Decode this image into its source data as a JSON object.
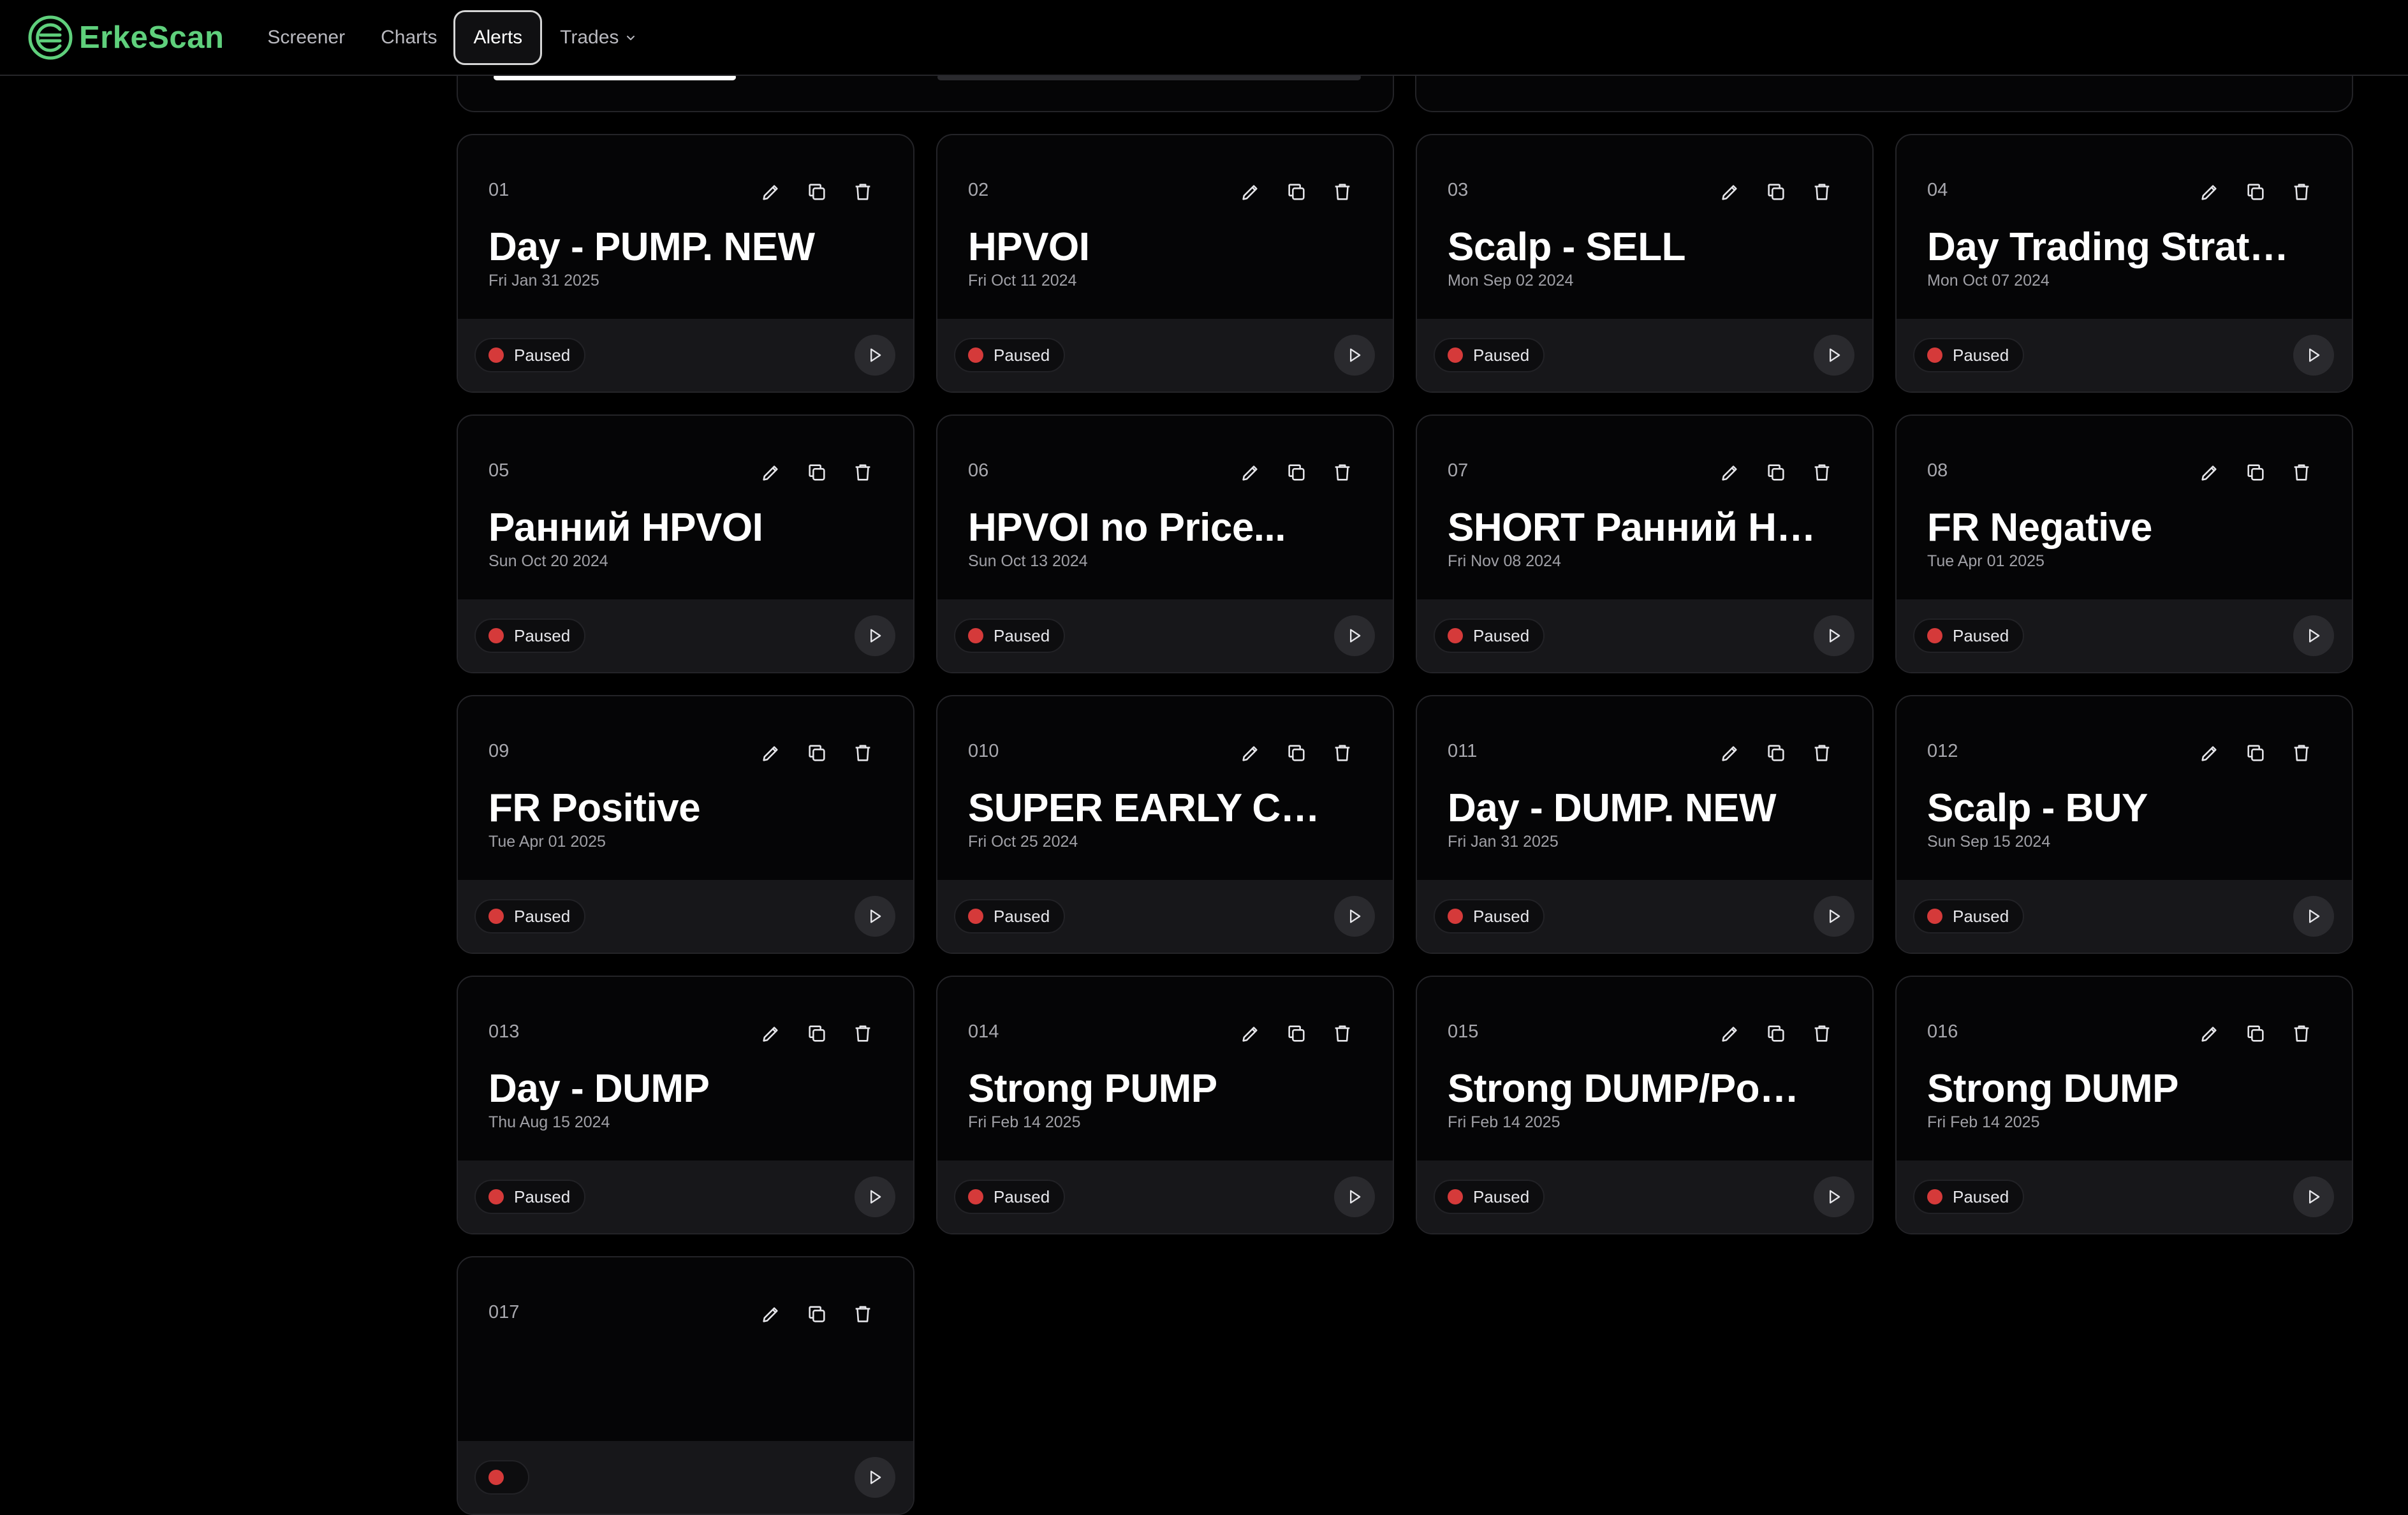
{
  "app": {
    "name": "ErkeScan"
  },
  "nav": {
    "items": [
      {
        "label": "Screener",
        "active": false
      },
      {
        "label": "Charts",
        "active": false
      },
      {
        "label": "Alerts",
        "active": true
      },
      {
        "label": "Trades",
        "active": false,
        "dropdown": true
      }
    ]
  },
  "colors": {
    "brand": "#5fd07c",
    "paused_dot": "#d53a3a",
    "background": "#000000",
    "card": "#050506",
    "card_footer": "#17171a"
  },
  "icons": {
    "edit": "pencil-icon",
    "copy": "copy-icon",
    "delete": "trash-icon",
    "play": "play-icon"
  },
  "alerts": [
    {
      "num": "01",
      "title": "Day - PUMP. NEW",
      "date": "Fri Jan 31 2025",
      "status": "Paused"
    },
    {
      "num": "02",
      "title": "HPVOI",
      "date": "Fri Oct 11 2024",
      "status": "Paused"
    },
    {
      "num": "03",
      "title": "Scalp - SELL",
      "date": "Mon Sep 02 2024",
      "status": "Paused"
    },
    {
      "num": "04",
      "title": "Day Trading Strateg...",
      "date": "Mon Oct 07 2024",
      "status": "Paused"
    },
    {
      "num": "05",
      "title": "Ранний HPVOI",
      "date": "Sun Oct 20 2024",
      "status": "Paused"
    },
    {
      "num": "06",
      "title": "HPVOI no Price...",
      "date": "Sun Oct 13 2024",
      "status": "Paused"
    },
    {
      "num": "07",
      "title": "SHORT Ранний HPVOI",
      "date": "Fri Nov 08 2024",
      "status": "Paused"
    },
    {
      "num": "08",
      "title": "FR Negative",
      "date": "Tue Apr 01 2025",
      "status": "Paused"
    },
    {
      "num": "09",
      "title": "FR Positive",
      "date": "Tue Apr 01 2025",
      "status": "Paused"
    },
    {
      "num": "010",
      "title": "SUPER EARLY CALL",
      "date": "Fri Oct 25 2024",
      "status": "Paused"
    },
    {
      "num": "011",
      "title": "Day - DUMP. NEW",
      "date": "Fri Jan 31 2025",
      "status": "Paused"
    },
    {
      "num": "012",
      "title": "Scalp - BUY",
      "date": "Sun Sep 15 2024",
      "status": "Paused"
    },
    {
      "num": "013",
      "title": "Day - DUMP",
      "date": "Thu Aug 15 2024",
      "status": "Paused"
    },
    {
      "num": "014",
      "title": "Strong PUMP",
      "date": "Fri Feb 14 2025",
      "status": "Paused"
    },
    {
      "num": "015",
      "title": "Strong DUMP/Positi...",
      "date": "Fri Feb 14 2025",
      "status": "Paused"
    },
    {
      "num": "016",
      "title": "Strong DUMP",
      "date": "Fri Feb 14 2025",
      "status": "Paused"
    },
    {
      "num": "017",
      "title": "",
      "date": "",
      "status": ""
    }
  ]
}
